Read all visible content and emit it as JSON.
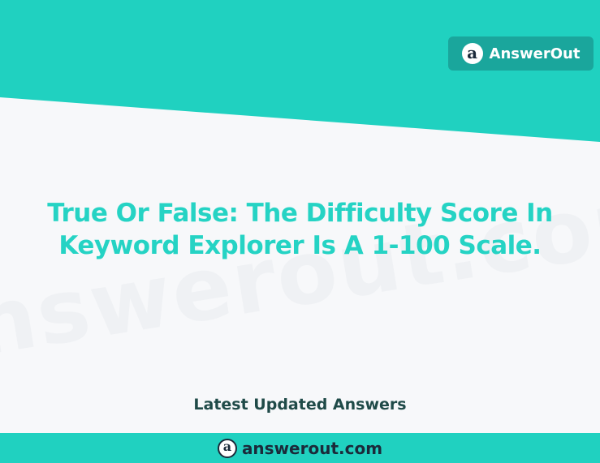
{
  "brand": {
    "logo_glyph": "a",
    "name": "AnswerOut"
  },
  "watermark": "answerout.com",
  "question": "True Or False: The Difficulty Score In Keyword Explorer Is A 1-100 Scale.",
  "caption": "Latest Updated Answers",
  "footer": {
    "logo_glyph": "a",
    "url": "answerout.com"
  },
  "colors": {
    "accent": "#20d1c0",
    "badge": "#1aa69c",
    "question_text": "#25d3c4",
    "caption_text": "#1f4a48",
    "background": "#f7f8fa"
  }
}
